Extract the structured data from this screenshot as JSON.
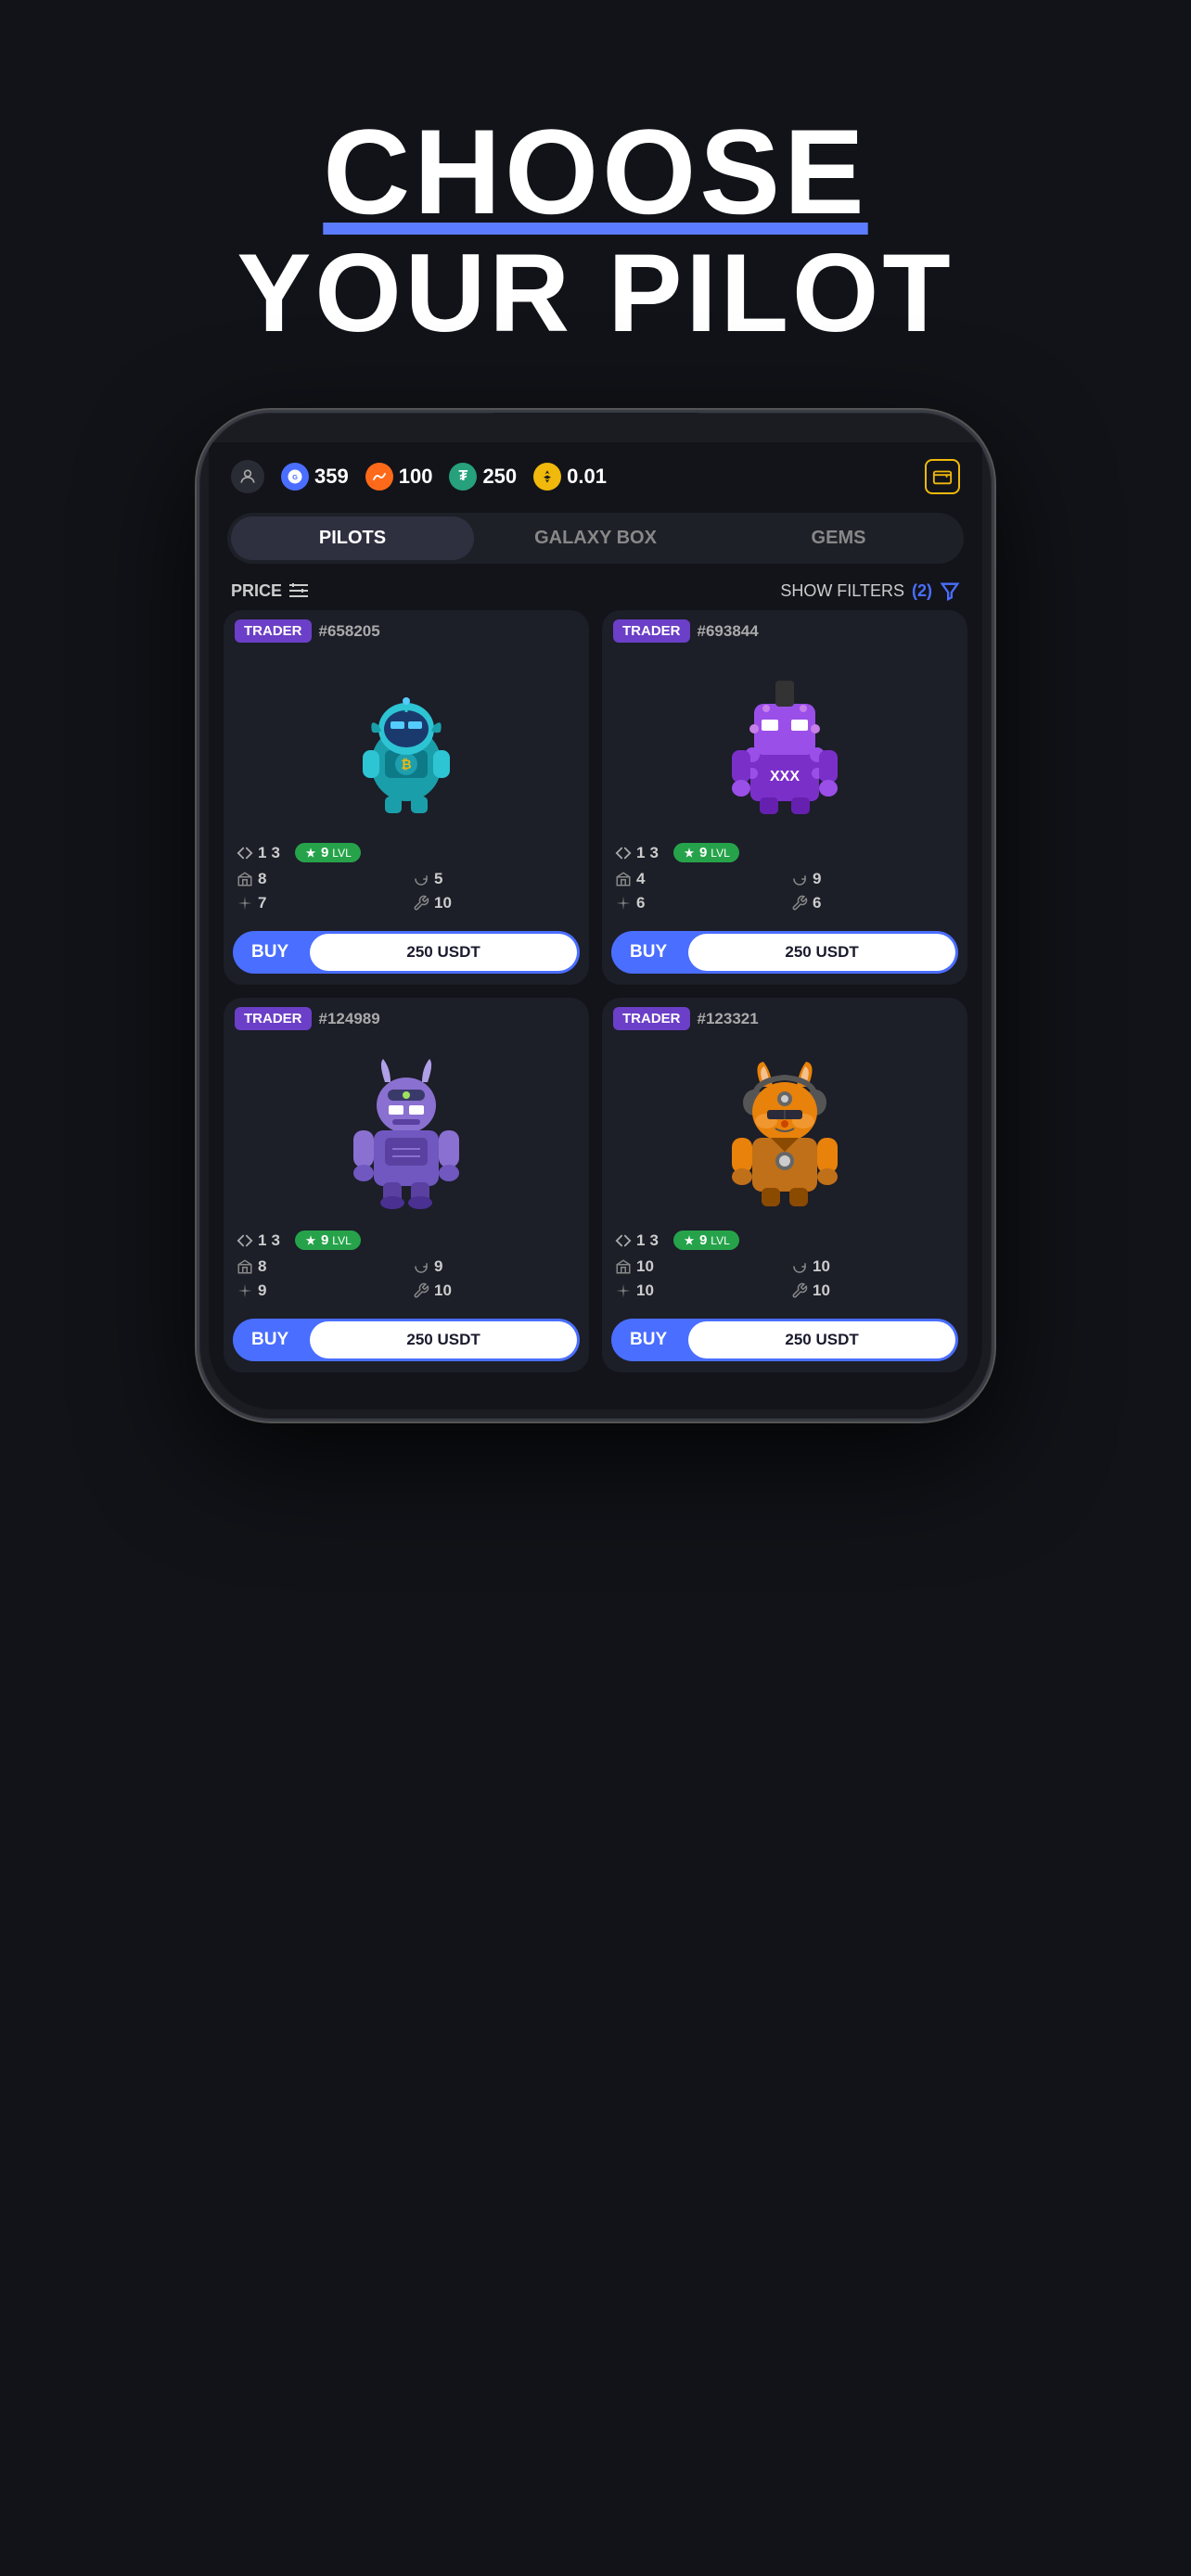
{
  "hero": {
    "line1": "CHOOSE",
    "line2": "YOUR PILOT"
  },
  "wallet": {
    "gf_amount": "359",
    "waves_amount": "100",
    "tether_amount": "250",
    "bnb_amount": "0.01"
  },
  "tabs": [
    {
      "id": "pilots",
      "label": "PILOTS",
      "active": true
    },
    {
      "id": "galaxy",
      "label": "GALAXY BOX",
      "active": false
    },
    {
      "id": "gems",
      "label": "GEMS",
      "active": false
    }
  ],
  "filter": {
    "price_label": "PRICE",
    "show_filters_label": "SHOW FILTERS",
    "filter_count": "(2)"
  },
  "pilots": [
    {
      "type": "TRADER",
      "id": "#658205",
      "stats_arrows": "1",
      "stats_arrows2": "3",
      "level": "9",
      "buildings": "8",
      "cycles": "5",
      "sparkle": "7",
      "wrench": "10",
      "price": "250 USDT",
      "color": "teal"
    },
    {
      "type": "TRADER",
      "id": "#693844",
      "stats_arrows": "1",
      "stats_arrows2": "3",
      "level": "9",
      "buildings": "4",
      "cycles": "9",
      "sparkle": "6",
      "wrench": "6",
      "price": "250 USDT",
      "color": "purple"
    },
    {
      "type": "TRADER",
      "id": "#124989",
      "stats_arrows": "1",
      "stats_arrows2": "3",
      "level": "9",
      "buildings": "8",
      "cycles": "9",
      "sparkle": "9",
      "wrench": "10",
      "price": "250 USDT",
      "color": "lavender"
    },
    {
      "type": "TRADER",
      "id": "#123321",
      "stats_arrows": "1",
      "stats_arrows2": "3",
      "level": "9",
      "buildings": "10",
      "cycles": "10",
      "sparkle": "10",
      "wrench": "10",
      "price": "250 USDT",
      "color": "orange"
    }
  ],
  "buy_label": "BUY"
}
